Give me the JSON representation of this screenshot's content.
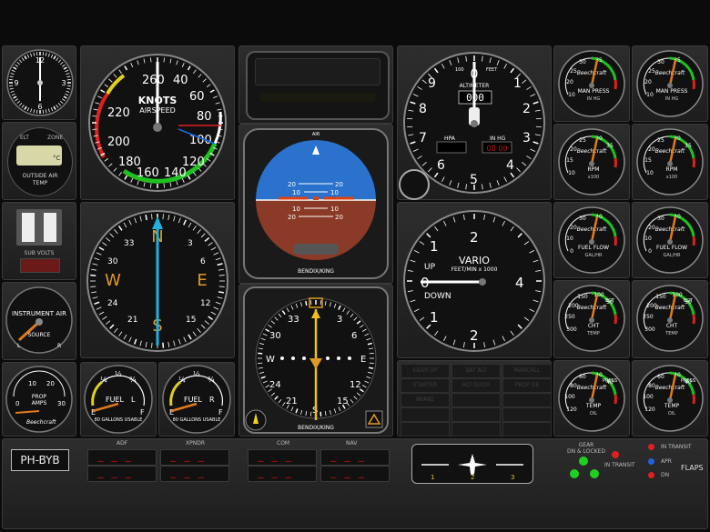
{
  "clock": {
    "labels": [
      "12",
      "3",
      "6",
      "9"
    ]
  },
  "oat": {
    "header_left": "ELT",
    "header_right": "ZONE",
    "unit": "°C",
    "label_line1": "OUTSIDE AIR",
    "label_line2": "TEMP"
  },
  "airspeed": {
    "title": "KNOTS",
    "subtitle": "AIRSPEED",
    "ticks": [
      "260",
      "40",
      "220",
      "60",
      "80",
      "200",
      "100",
      "180",
      "120",
      "160",
      "140"
    ]
  },
  "suction": {
    "label": "SUB VOLTS"
  },
  "instrument_air": {
    "title": "INSTRUMENT AIR",
    "left": "L",
    "right": "R",
    "sub": "SOURCE"
  },
  "compass": {
    "cardinals": [
      "N",
      "E",
      "S",
      "W"
    ],
    "ticks": [
      "3",
      "6",
      "12",
      "15",
      "21",
      "24",
      "30",
      "33"
    ]
  },
  "attitude": {
    "brand": "BENDIX/KING",
    "top_label": "AIR",
    "pitch_marks": [
      "20",
      "10",
      "10",
      "20",
      "20",
      "10",
      "10",
      "20"
    ]
  },
  "hsi": {
    "brand": "BENDIX/KING",
    "ticks": [
      "33",
      "30",
      "3",
      "6",
      "12",
      "15",
      "24",
      "21",
      "W",
      "E",
      "S"
    ]
  },
  "altimeter": {
    "title": "ALTIMETER",
    "top_left": "100",
    "top_right": "FEET",
    "digits": "000",
    "hpa_label": "HPA",
    "inhg_label": "IN HG",
    "hpa_value": "",
    "inhg_value": "00 00",
    "numbers": [
      "0",
      "1",
      "2",
      "3",
      "4",
      "5",
      "6",
      "7",
      "8",
      "9"
    ]
  },
  "vario": {
    "title": "VARIO",
    "sub": "FEET/MIN x 1000",
    "up": "UP",
    "down": "DOWN",
    "numbers": [
      "0",
      "1",
      "2",
      "4",
      "2",
      "1"
    ]
  },
  "engine_gauges": [
    {
      "brand": "Beechcraft",
      "label": "MAN PRESS",
      "unit": "IN HG",
      "nums": [
        "10",
        "20",
        "25",
        "30",
        "35"
      ]
    },
    {
      "brand": "Beechcraft",
      "label": "MAN PRESS",
      "unit": "IN HG",
      "nums": [
        "10",
        "20",
        "25",
        "30",
        "35"
      ]
    },
    {
      "brand": "Beechcraft",
      "label": "RPM",
      "unit": "x100",
      "nums": [
        "10",
        "15",
        "20",
        "25",
        "30",
        "35"
      ]
    },
    {
      "brand": "Beechcraft",
      "label": "RPM",
      "unit": "x100",
      "nums": [
        "10",
        "15",
        "20",
        "25",
        "30",
        "35"
      ]
    },
    {
      "brand": "Beechcraft",
      "label": "FUEL FLOW",
      "unit": "GAL/HR",
      "nums": [
        "0",
        "10",
        "20",
        "30",
        "40"
      ]
    },
    {
      "brand": "Beechcraft",
      "label": "FUEL FLOW",
      "unit": "GAL/HR",
      "nums": [
        "0",
        "10",
        "20",
        "30",
        "40"
      ]
    },
    {
      "brand": "Beechcraft",
      "label": "CHT",
      "label2": "EGT",
      "unit": "TEMP",
      "nums": [
        "300",
        "250",
        "200",
        "150",
        "100",
        "50",
        "20°C"
      ]
    },
    {
      "brand": "Beechcraft",
      "label": "CHT",
      "label2": "EGT",
      "unit": "TEMP",
      "nums": [
        "300",
        "250",
        "200",
        "150",
        "100",
        "50",
        "20°C"
      ]
    },
    {
      "brand": "Beechcraft",
      "label": "TEMP",
      "label2": "PRESS",
      "unit": "OIL",
      "nums": [
        "120",
        "100",
        "80",
        "60",
        "40",
        "40",
        "80"
      ]
    },
    {
      "brand": "Beechcraft",
      "label": "TEMP",
      "label2": "PRESS",
      "unit": "OIL",
      "nums": [
        "120",
        "100",
        "80",
        "60",
        "40",
        "40",
        "80"
      ]
    }
  ],
  "prop_amps": {
    "label": "PROP",
    "unit": "AMPS",
    "nums": [
      "0",
      "10",
      "20",
      "30"
    ],
    "brand": "Beechcraft"
  },
  "fuel_left": {
    "label": "FUEL",
    "side": "L",
    "sub": "80 GALLONS USABLE",
    "marks": [
      "E",
      "¼",
      "½",
      "¾",
      "F"
    ]
  },
  "fuel_right": {
    "label": "FUEL",
    "side": "R",
    "sub": "80 GALLONS USABLE",
    "marks": [
      "E",
      "¼",
      "½",
      "¾",
      "F"
    ]
  },
  "registration": "PH-BYB",
  "radios": {
    "adf": "ADF",
    "xpndr": "XPNDR",
    "com": "COM",
    "nav": "NAV"
  },
  "annunciators": [
    "GEAR UP",
    "BAT ALT",
    "MANCALL",
    "STARTER",
    "ALT DOOR",
    "PROP DE",
    "BRAKE",
    "",
    "",
    "",
    "",
    "",
    "",
    "",
    "",
    ""
  ],
  "trim": {
    "marks": [
      "1",
      "2",
      "3"
    ]
  },
  "gear": {
    "title_line1": "GEAR",
    "title_line2": "DN & LOCKED",
    "transit": "IN TRANSIT"
  },
  "flaps": {
    "in_transit": "IN TRANSIT",
    "apr": "APR",
    "dn": "DN",
    "label": "FLAPS"
  }
}
